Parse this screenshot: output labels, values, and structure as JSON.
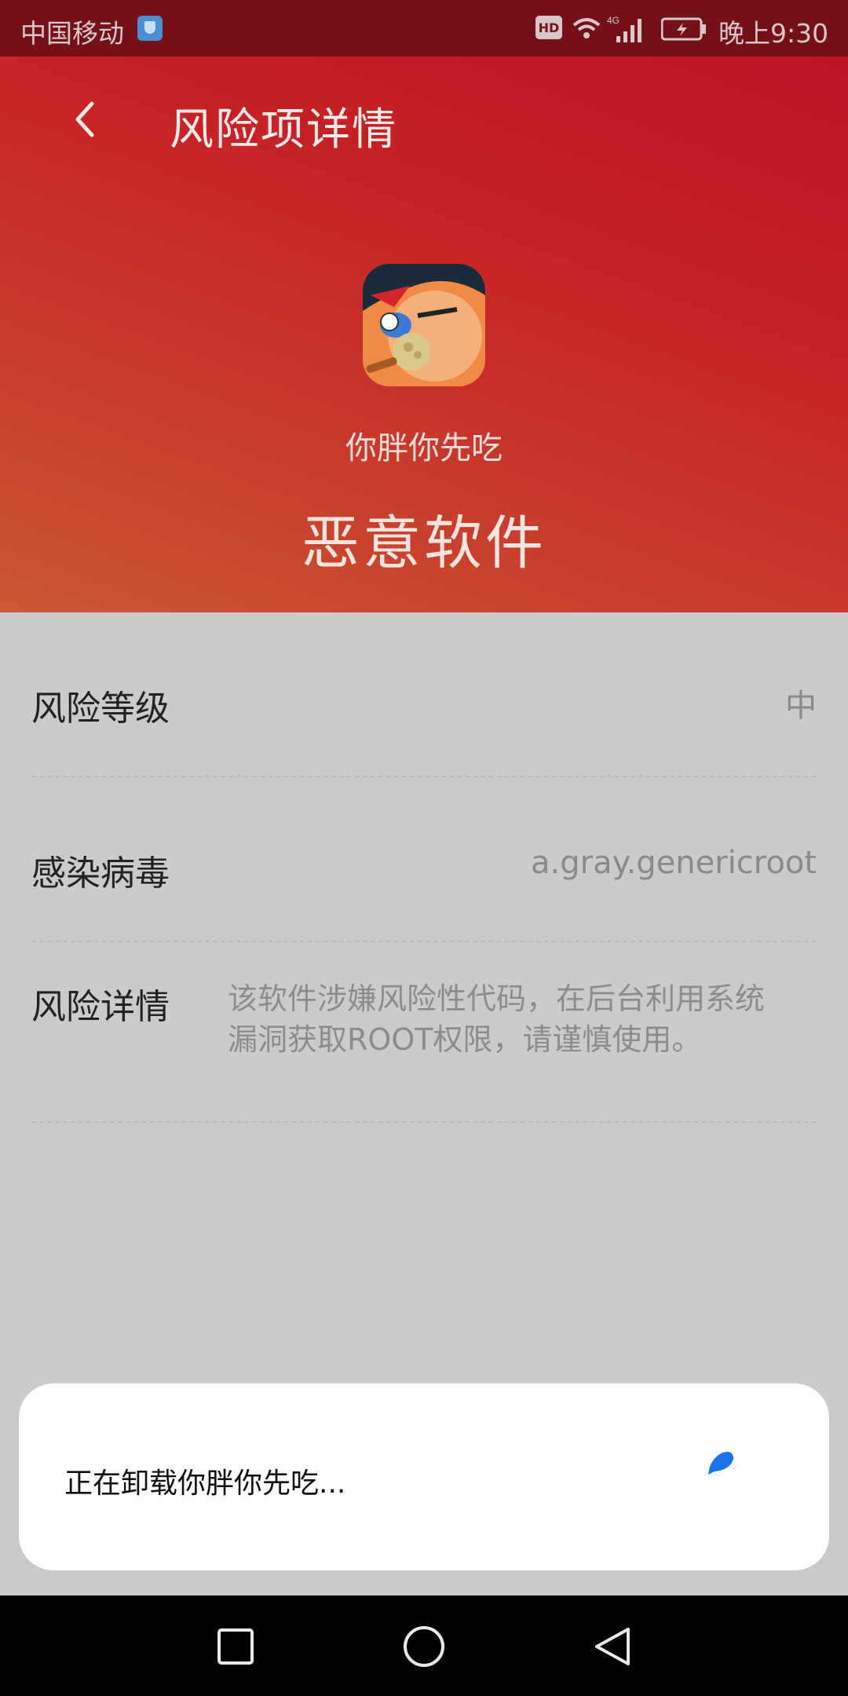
{
  "status_bar": {
    "carrier": "中国移动",
    "network": "4G",
    "hd_badge": "HD",
    "time": "晚上9:30"
  },
  "header": {
    "title": "风险项详情",
    "back_icon": "chevron-left-icon"
  },
  "app": {
    "name": "你胖你先吃",
    "risk_type": "恶意软件",
    "icon": "cartoon-face-app-icon"
  },
  "details": {
    "level_label": "风险等级",
    "level_value": "中",
    "virus_label": "感染病毒",
    "virus_value": "a.gray.genericroot",
    "risk_label": "风险详情",
    "risk_text": "该软件涉嫌风险性代码，在后台利用系统漏洞获取ROOT权限，请谨慎使用。"
  },
  "dialog": {
    "message": "正在卸载你胖你先吃...",
    "spinner_color": "#1a73e8"
  },
  "nav": {
    "recent_icon": "square-recents-icon",
    "home_icon": "circle-home-icon",
    "back_icon": "triangle-back-icon"
  }
}
